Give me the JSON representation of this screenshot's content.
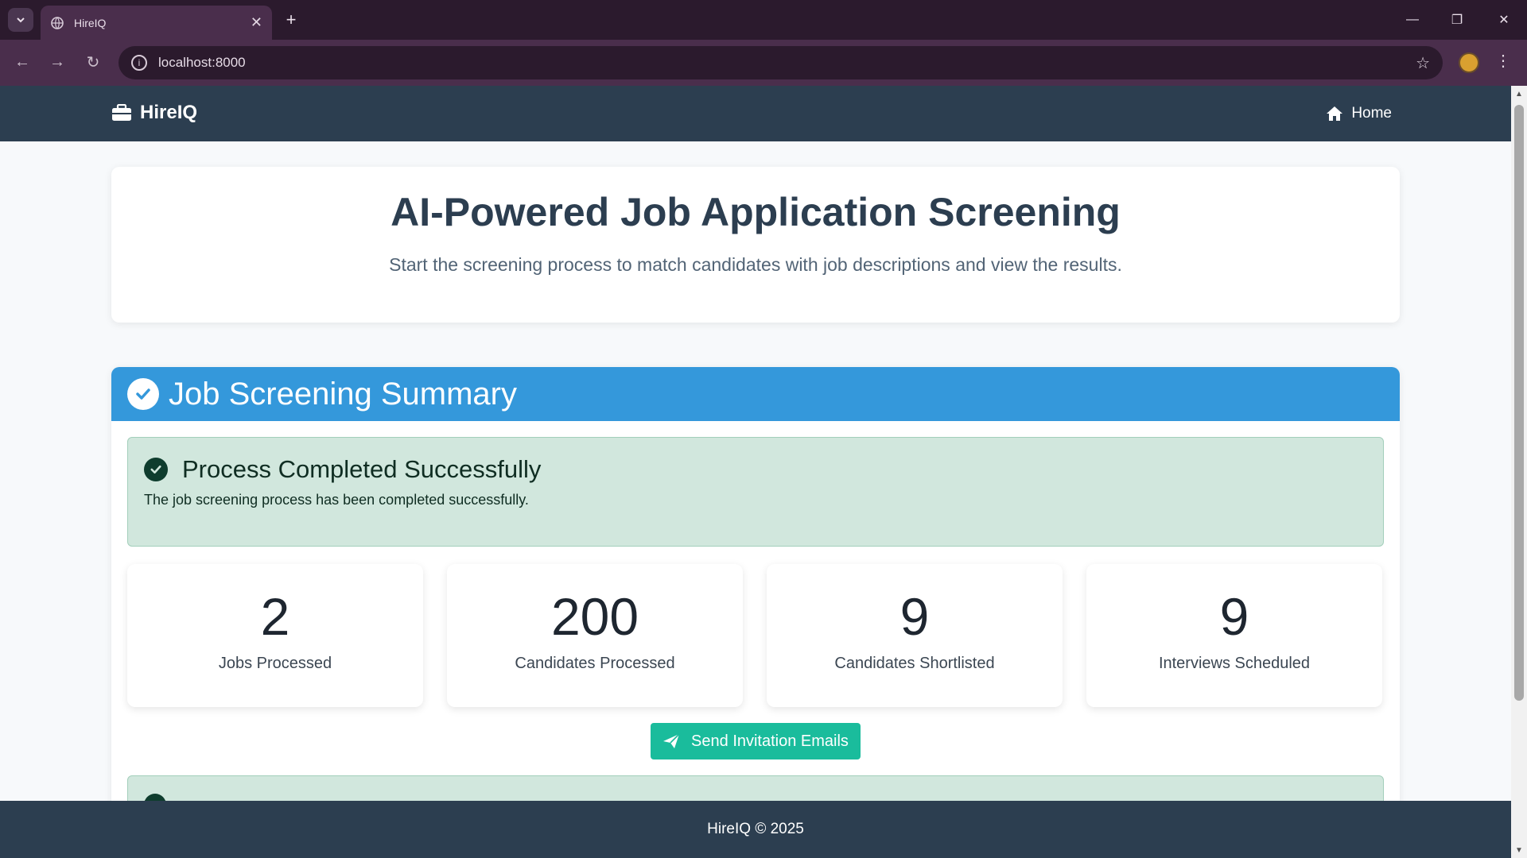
{
  "browser": {
    "tab_title": "HireIQ",
    "url": "localhost:8000"
  },
  "nav": {
    "brand": "HireIQ",
    "home_label": "Home"
  },
  "hero": {
    "title": "AI-Powered Job Application Screening",
    "subtitle": "Start the screening process to match candidates with job descriptions and view the results."
  },
  "summary": {
    "title": "Job Screening Summary",
    "alert_title": "Process Completed Successfully",
    "alert_text": "The job screening process has been completed successfully.",
    "stats": [
      {
        "value": "2",
        "label": "Jobs Processed"
      },
      {
        "value": "200",
        "label": "Candidates Processed"
      },
      {
        "value": "9",
        "label": "Candidates Shortlisted"
      },
      {
        "value": "9",
        "label": "Interviews Scheduled"
      }
    ],
    "send_button": "Send Invitation Emails"
  },
  "footer": {
    "text": "HireIQ © 2025"
  },
  "colors": {
    "nav": "#2c3e50",
    "accent_blue": "#3498db",
    "success_bg": "#d1e7dd",
    "button_teal": "#1abc9c"
  }
}
